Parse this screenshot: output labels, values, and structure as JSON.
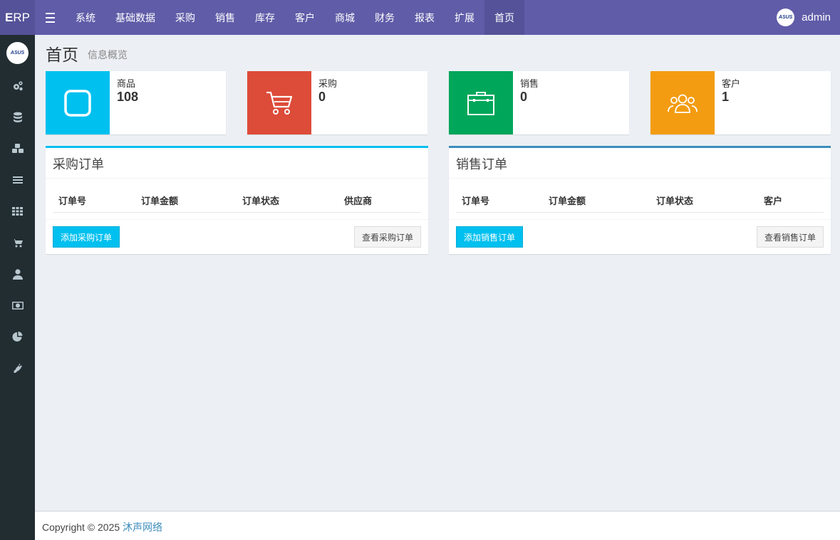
{
  "brand": {
    "logo_e": "E",
    "logo_rest": "RP"
  },
  "nav": {
    "items": [
      "系统",
      "基础数据",
      "采购",
      "销售",
      "库存",
      "客户",
      "商城",
      "财务",
      "报表",
      "扩展",
      "首页"
    ],
    "active_index": 10
  },
  "user": {
    "name": "admin",
    "avatar_text": "ASUS"
  },
  "sidebar": {
    "icons": [
      "gears-icon",
      "database-icon",
      "cubes-icon",
      "list-icon",
      "grid-icon",
      "cart-icon",
      "user-icon",
      "money-icon",
      "pie-chart-icon",
      "plug-icon"
    ]
  },
  "page": {
    "title": "首页",
    "subtitle": "信息概览"
  },
  "stats": [
    {
      "label": "商品",
      "value": "108",
      "color": "#00c0ef",
      "icon": "square-icon"
    },
    {
      "label": "采购",
      "value": "0",
      "color": "#dd4b39",
      "icon": "cart-icon"
    },
    {
      "label": "销售",
      "value": "0",
      "color": "#00a65a",
      "icon": "briefcase-icon"
    },
    {
      "label": "客户",
      "value": "1",
      "color": "#f39c12",
      "icon": "users-icon"
    }
  ],
  "purchase_panel": {
    "title": "采购订单",
    "border_color": "#00c0ef",
    "columns": [
      "订单号",
      "订单金额",
      "订单状态",
      "供应商"
    ],
    "add_label": "添加采购订单",
    "view_label": "查看采购订单"
  },
  "sales_panel": {
    "title": "销售订单",
    "border_color": "#3c8dbc",
    "columns": [
      "订单号",
      "订单金额",
      "订单状态",
      "客户"
    ],
    "add_label": "添加销售订单",
    "view_label": "查看销售订单"
  },
  "footer": {
    "copyright": "Copyright © 2025",
    "company": "沐声网络"
  }
}
